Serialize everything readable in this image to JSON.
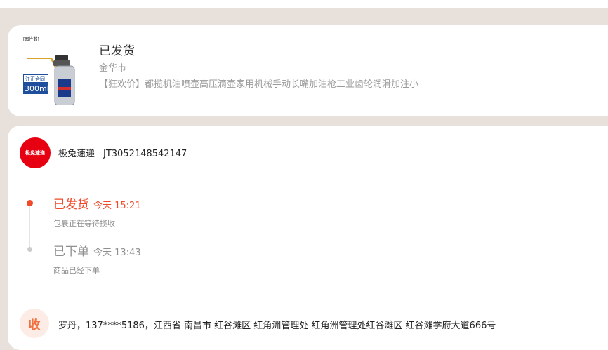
{
  "product": {
    "status": "已发货",
    "city": "金华市",
    "name": "【狂欢价】都揽机油喷壶高压滴壶家用机械手动长嘴加油枪工业齿轮润滑加注小",
    "image": {
      "label_top": "[图片数]",
      "label_mid": "江正合同",
      "capacity": "300ml"
    }
  },
  "logistics": {
    "carrier_logo_text": "极兔速递",
    "carrier_name": "极兔速递",
    "tracking_number": "JT3052148542147",
    "events": [
      {
        "title": "已发货",
        "time": "今天 15:21",
        "desc": "包裹正在等待揽收"
      },
      {
        "title": "已下单",
        "time": "今天 13:43",
        "desc": "商品已经下单"
      }
    ],
    "recipient_icon_text": "收",
    "address": "罗丹，137****5186，江西省 南昌市 红谷滩区 红角洲管理处 红角洲管理处红谷滩区 红谷滩学府大道666号"
  },
  "colors": {
    "accent": "#f04a2a",
    "carrier_red": "#e60012",
    "background": "#e8e0da"
  }
}
